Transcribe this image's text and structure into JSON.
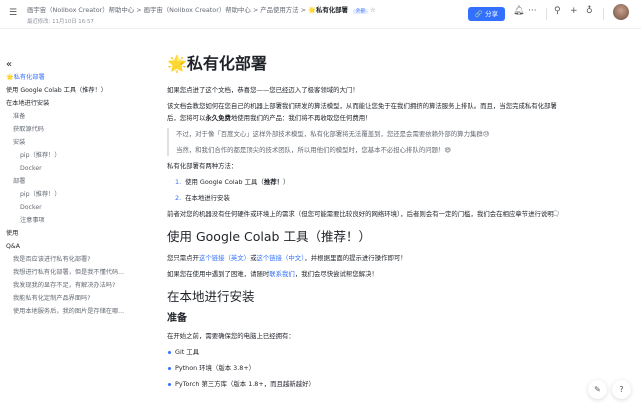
{
  "header": {
    "crumbs": [
      "画宇宙（Nolibox Creator）帮助中心",
      "画宇宙（Nolibox Creator）帮助中心",
      "产品使用方法"
    ],
    "current": "🌟私有化部署",
    "badge": "外部",
    "meta": "最近修改: 11月10日 16:57",
    "share": "分享"
  },
  "sidebar": {
    "collapse": "«",
    "items": [
      {
        "label": "🌟私有化部署",
        "level": 1
      },
      {
        "label": "使用 Google Colab 工具（推荐！）",
        "level": 1
      },
      {
        "label": "在本地进行安装",
        "level": 1
      },
      {
        "label": "准备",
        "level": 2
      },
      {
        "label": "获取源代码",
        "level": 2
      },
      {
        "label": "安装",
        "level": 2
      },
      {
        "label": "pip（推荐！）",
        "level": 3
      },
      {
        "label": "Docker",
        "level": 3
      },
      {
        "label": "部署",
        "level": 2
      },
      {
        "label": "pip（推荐！）",
        "level": 3
      },
      {
        "label": "Docker",
        "level": 3
      },
      {
        "label": "注意事项",
        "level": 3
      },
      {
        "label": "使用",
        "level": 1
      },
      {
        "label": "Q&A",
        "level": 1
      },
      {
        "label": "我是否应该进行私有化部署?",
        "level": 2
      },
      {
        "label": "我想进行私有化部署，但是我不懂代码...",
        "level": 2
      },
      {
        "label": "我发现我的显存不足，有解决办法吗?",
        "level": 2
      },
      {
        "label": "我能私有化定制产品界面吗?",
        "level": 2
      },
      {
        "label": "使用本地服务后，我的图片是存储在哪...",
        "level": 2
      }
    ]
  },
  "doc": {
    "title": "🌟私有化部署",
    "p1": "如果您点进了这个文档，恭喜您——您已经迈入了极客领域的大门！",
    "p2a": "该文档会教您如何在您自己的机器上部署我们研发的算法模型，从而能让您免于在我们拥挤的算法服务上排队。而且，当您完成私有化部署后，您将可以",
    "p2b": "永久免费",
    "p2c": "地使用我们的产品：我们将不再收取您任何费用！",
    "q1": "不过，对于像「百度文心」这样外部技术模型，私有化部署将无法覆盖到，您还是会需要依赖外部的算力集群😓",
    "q2": "当然，和我们合作的都是顶尖的技术团队，所以用他们的模型时，您基本不必担心排队的问题！😄",
    "p3": "私有化部署有两种方法：",
    "ol": [
      {
        "n": "1.",
        "a": "使用 Google Colab 工具（",
        "b": "推荐！",
        "c": "）"
      },
      {
        "n": "2.",
        "a": "在本地进行安装"
      }
    ],
    "p4": "前者对您的机器没有任何硬件或环境上的需求（但您可能需要比较良好的网络环境），后者则会有一定的门槛，我们会在相应章节进行说明",
    "h2a": "使用 Google Colab 工具（推荐！）",
    "p5": {
      "a": "您只需点开",
      "l1": "这个链接（英文）",
      "b": "或",
      "l2": "这个链接（中文）",
      "c": "，并根据里面的提示进行操作即可！"
    },
    "p6": {
      "a": "如果您在使用中遇到了困难，请随时",
      "l": "联系我们",
      "b": "，我们会尽快尝试帮您解决！"
    },
    "h2b": "在本地进行安装",
    "h3": "准备",
    "p7": "在开始之前，需要确保您的电脑上已经拥有：",
    "ul": [
      "Git 工具",
      "Python 环境（版本 3.8+）",
      "PyTorch 第三方库（版本 1.8+，而且越新越好）"
    ]
  }
}
